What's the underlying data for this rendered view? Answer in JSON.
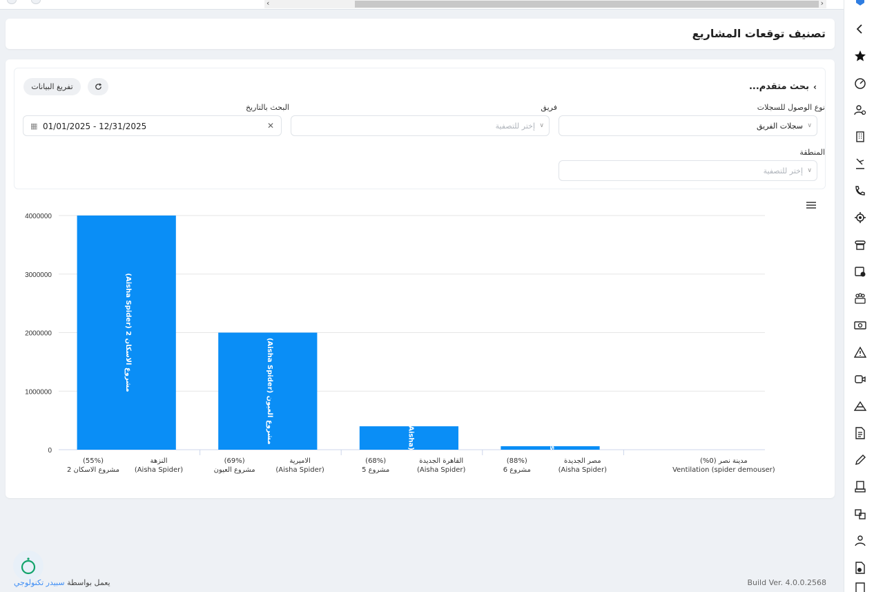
{
  "header": {
    "title": "تصنيف توقعات المشاريع"
  },
  "filters": {
    "advanced_search_label": "بحث متقدم...",
    "export_button_label": "تفريغ البيانات",
    "access_type_label": "نوع الوصول للسجلات",
    "access_type_value": "سجلات الفريق",
    "team_label": "فريق",
    "team_placeholder": "إختر للتصفية",
    "date_label": "البحث بالتاريخ",
    "date_value": "01/01/2025 - 12/31/2025",
    "region_label": "المنطقة",
    "region_placeholder": "إختر للتصفية"
  },
  "chart_data": {
    "type": "bar",
    "ylim": [
      0,
      4000000
    ],
    "yticks": [
      0,
      1000000,
      2000000,
      3000000,
      4000000
    ],
    "grid": true,
    "groups": [
      {
        "left": {
          "percent": "(55%)",
          "name": "مشروع الاسكان 2"
        },
        "right": {
          "name": "النزهة",
          "team": "(Aisha Spider)"
        },
        "value": 4000000,
        "bar_label": "مشروع الاسكان 2 (Aisha Spider)"
      },
      {
        "left": {
          "percent": "(69%)",
          "name": "مشروع العيون"
        },
        "right": {
          "name": "الاميرية",
          "team": "(Aisha Spider)"
        },
        "value": 2000000,
        "bar_label": "مشروع العيون (Aisha Spider)"
      },
      {
        "left": {
          "percent": "(68%)",
          "name": "مشروع 5"
        },
        "right": {
          "name": "القاهرة الجديدة",
          "team": "(Aisha Spider)"
        },
        "value": 400000,
        "bar_label": "(Aisha"
      },
      {
        "left": {
          "percent": "(88%)",
          "name": "مشروع 6"
        },
        "right": {
          "name": "مصر الجديدة",
          "team": "(Aisha Spider)"
        },
        "value": 60000,
        "bar_label": "s"
      },
      {
        "left": {
          "percent": "",
          "name": ""
        },
        "right": {
          "name": "مدينة نصر (0%)",
          "team": "Ventilation (spider demouser)"
        },
        "value": 0,
        "bar_label": ""
      }
    ],
    "bar_color": "#0a8ef6"
  },
  "footer": {
    "powered_by": "يعمل بواسطة",
    "brand": "سبيدر تكنولوجي",
    "build": "Build Ver. 4.0.0.2568"
  },
  "icons": {
    "sidebar": [
      "chevron-left-icon",
      "star-icon",
      "gauge-icon",
      "users-icon",
      "building-icon",
      "sign-icon",
      "phone-icon",
      "target-icon",
      "telephone-icon",
      "calendar-add-icon",
      "team-icon",
      "money-icon",
      "warning-icon",
      "video-icon",
      "mountain-icon",
      "invoice-icon",
      "pen-icon",
      "document-truck-icon",
      "boxes-truck-icon",
      "user-hand-icon",
      "document-add-icon",
      "receipt-icon"
    ]
  }
}
